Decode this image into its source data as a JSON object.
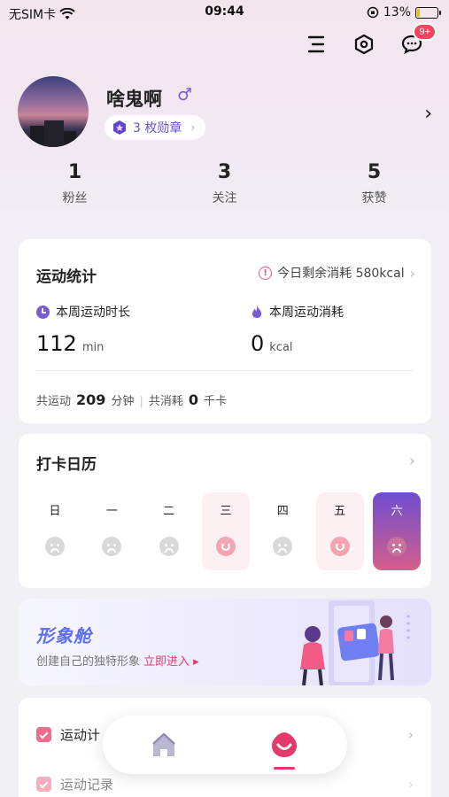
{
  "status_bar": {
    "carrier": "无SIM卡",
    "time": "09:44",
    "battery_percent": "13%",
    "battery_level": 0.13
  },
  "header": {
    "notification_badge": "9+"
  },
  "profile": {
    "name": "啥鬼啊",
    "gender_symbol": "♂",
    "medal_text": "3 枚勋章"
  },
  "stats": [
    {
      "value": "1",
      "label": "粉丝"
    },
    {
      "value": "3",
      "label": "关注"
    },
    {
      "value": "5",
      "label": "获赞"
    }
  ],
  "sport_stats": {
    "title": "运动统计",
    "today_remaining": "今日剩余消耗 580kcal",
    "week_duration_label": "本周运动时长",
    "week_duration_value": "112",
    "week_duration_unit": "min",
    "week_burn_label": "本周运动消耗",
    "week_burn_value": "0",
    "week_burn_unit": "kcal",
    "summary_prefix": "共运动",
    "summary_minutes": "209",
    "summary_minutes_unit": "分钟",
    "summary_burn_prefix": "共消耗",
    "summary_burn": "0",
    "summary_burn_unit": "千卡"
  },
  "calendar": {
    "title": "打卡日历",
    "days": [
      {
        "name": "日",
        "state": "none"
      },
      {
        "name": "一",
        "state": "none"
      },
      {
        "name": "二",
        "state": "none"
      },
      {
        "name": "三",
        "state": "checked"
      },
      {
        "name": "四",
        "state": "none"
      },
      {
        "name": "五",
        "state": "checked"
      },
      {
        "name": "六",
        "state": "today"
      }
    ]
  },
  "avatar_card": {
    "title": "形象舱",
    "subtitle": "创建自己的独特形象",
    "enter": "立即进入 ▸"
  },
  "menu": [
    {
      "label": "运动计",
      "icon": "check-icon"
    },
    {
      "label": "运动记录",
      "icon": "record-icon"
    }
  ],
  "colors": {
    "accent_purple": "#6d4ed0",
    "accent_pink": "#e6396b"
  }
}
